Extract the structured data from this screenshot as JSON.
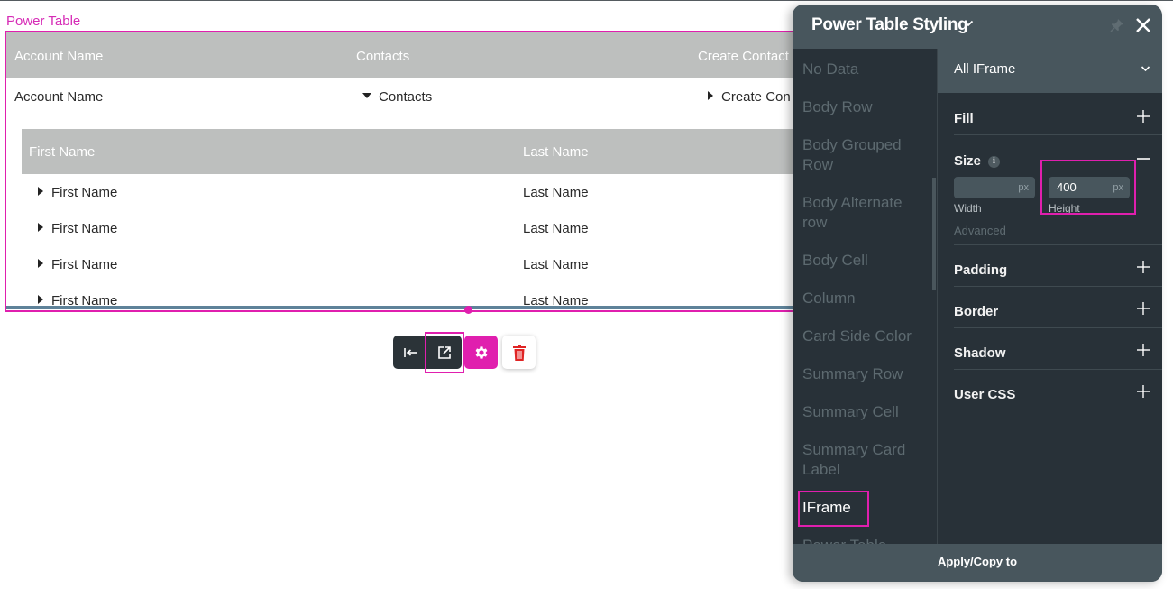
{
  "canvas": {
    "component_label": "Power Table",
    "table": {
      "columns": [
        "Account Name",
        "Contacts",
        "Create Contact"
      ],
      "row": {
        "account_name": "Account Name",
        "contacts": "Contacts",
        "create_contact": "Create Con"
      },
      "sub_table": {
        "columns": [
          "First Name",
          "Last Name"
        ],
        "rows": [
          {
            "first_name": "First Name",
            "last_name": "Last Name"
          },
          {
            "first_name": "First Name",
            "last_name": "Last Name"
          },
          {
            "first_name": "First Name",
            "last_name": "Last Name"
          },
          {
            "first_name": "First Name",
            "last_name": "Last Name"
          }
        ]
      }
    },
    "toolbar": {
      "buttons": [
        {
          "icon": "collapse-left-icon"
        },
        {
          "icon": "open-external-icon"
        },
        {
          "icon": "gear-icon"
        },
        {
          "icon": "trash-icon"
        }
      ],
      "accent_color": "#e01fae",
      "delete_color": "#e02424"
    }
  },
  "panel": {
    "title": "Power Table Styling",
    "element_list": [
      {
        "label": "No Data",
        "active": false
      },
      {
        "label": "Body Row",
        "active": false
      },
      {
        "label": "Body Grouped Row",
        "active": false
      },
      {
        "label": "Body Alternate row",
        "active": false
      },
      {
        "label": "Body Cell",
        "active": false
      },
      {
        "label": "Column",
        "active": false
      },
      {
        "label": "Card Side Color",
        "active": false
      },
      {
        "label": "Summary Row",
        "active": false
      },
      {
        "label": "Summary Cell",
        "active": false
      },
      {
        "label": "Summary Card Label",
        "active": false
      },
      {
        "label": "IFrame",
        "active": true
      },
      {
        "label": "Power Table",
        "active": false
      }
    ],
    "state_dropdown": "All IFrame",
    "sections": {
      "fill": "Fill",
      "size": "Size",
      "padding": "Padding",
      "border": "Border",
      "shadow": "Shadow",
      "user_css": "User CSS"
    },
    "size": {
      "width_value": "",
      "width_unit": "px",
      "width_label": "Width",
      "height_value": "400",
      "height_unit": "px",
      "height_label": "Height",
      "advanced_label": "Advanced",
      "info_glyph": "i"
    },
    "footer_button": "Apply/Copy to"
  }
}
